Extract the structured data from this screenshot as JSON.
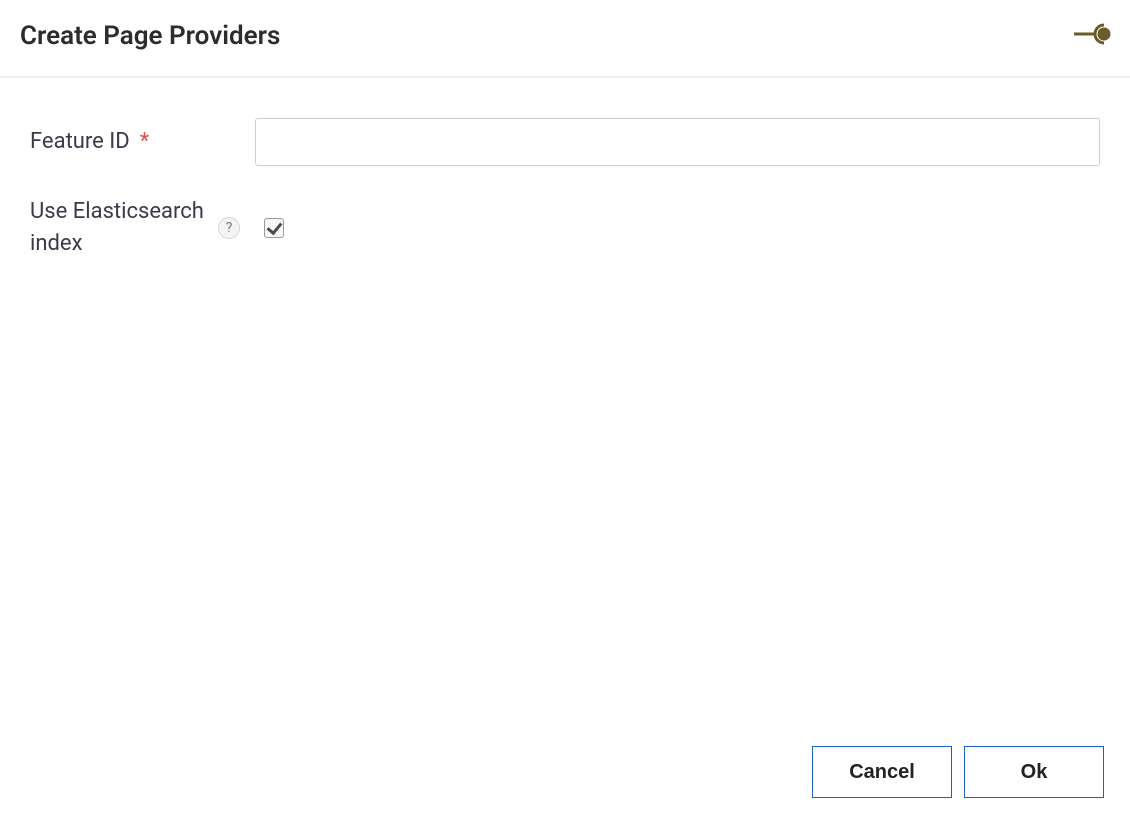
{
  "header": {
    "title": "Create Page Providers"
  },
  "form": {
    "feature_id": {
      "label": "Feature ID",
      "required_marker": "*",
      "value": ""
    },
    "use_es_index": {
      "label": "Use Elasticsearch index",
      "help_symbol": "?",
      "checked": true
    }
  },
  "footer": {
    "cancel_label": "Cancel",
    "ok_label": "Ok"
  }
}
